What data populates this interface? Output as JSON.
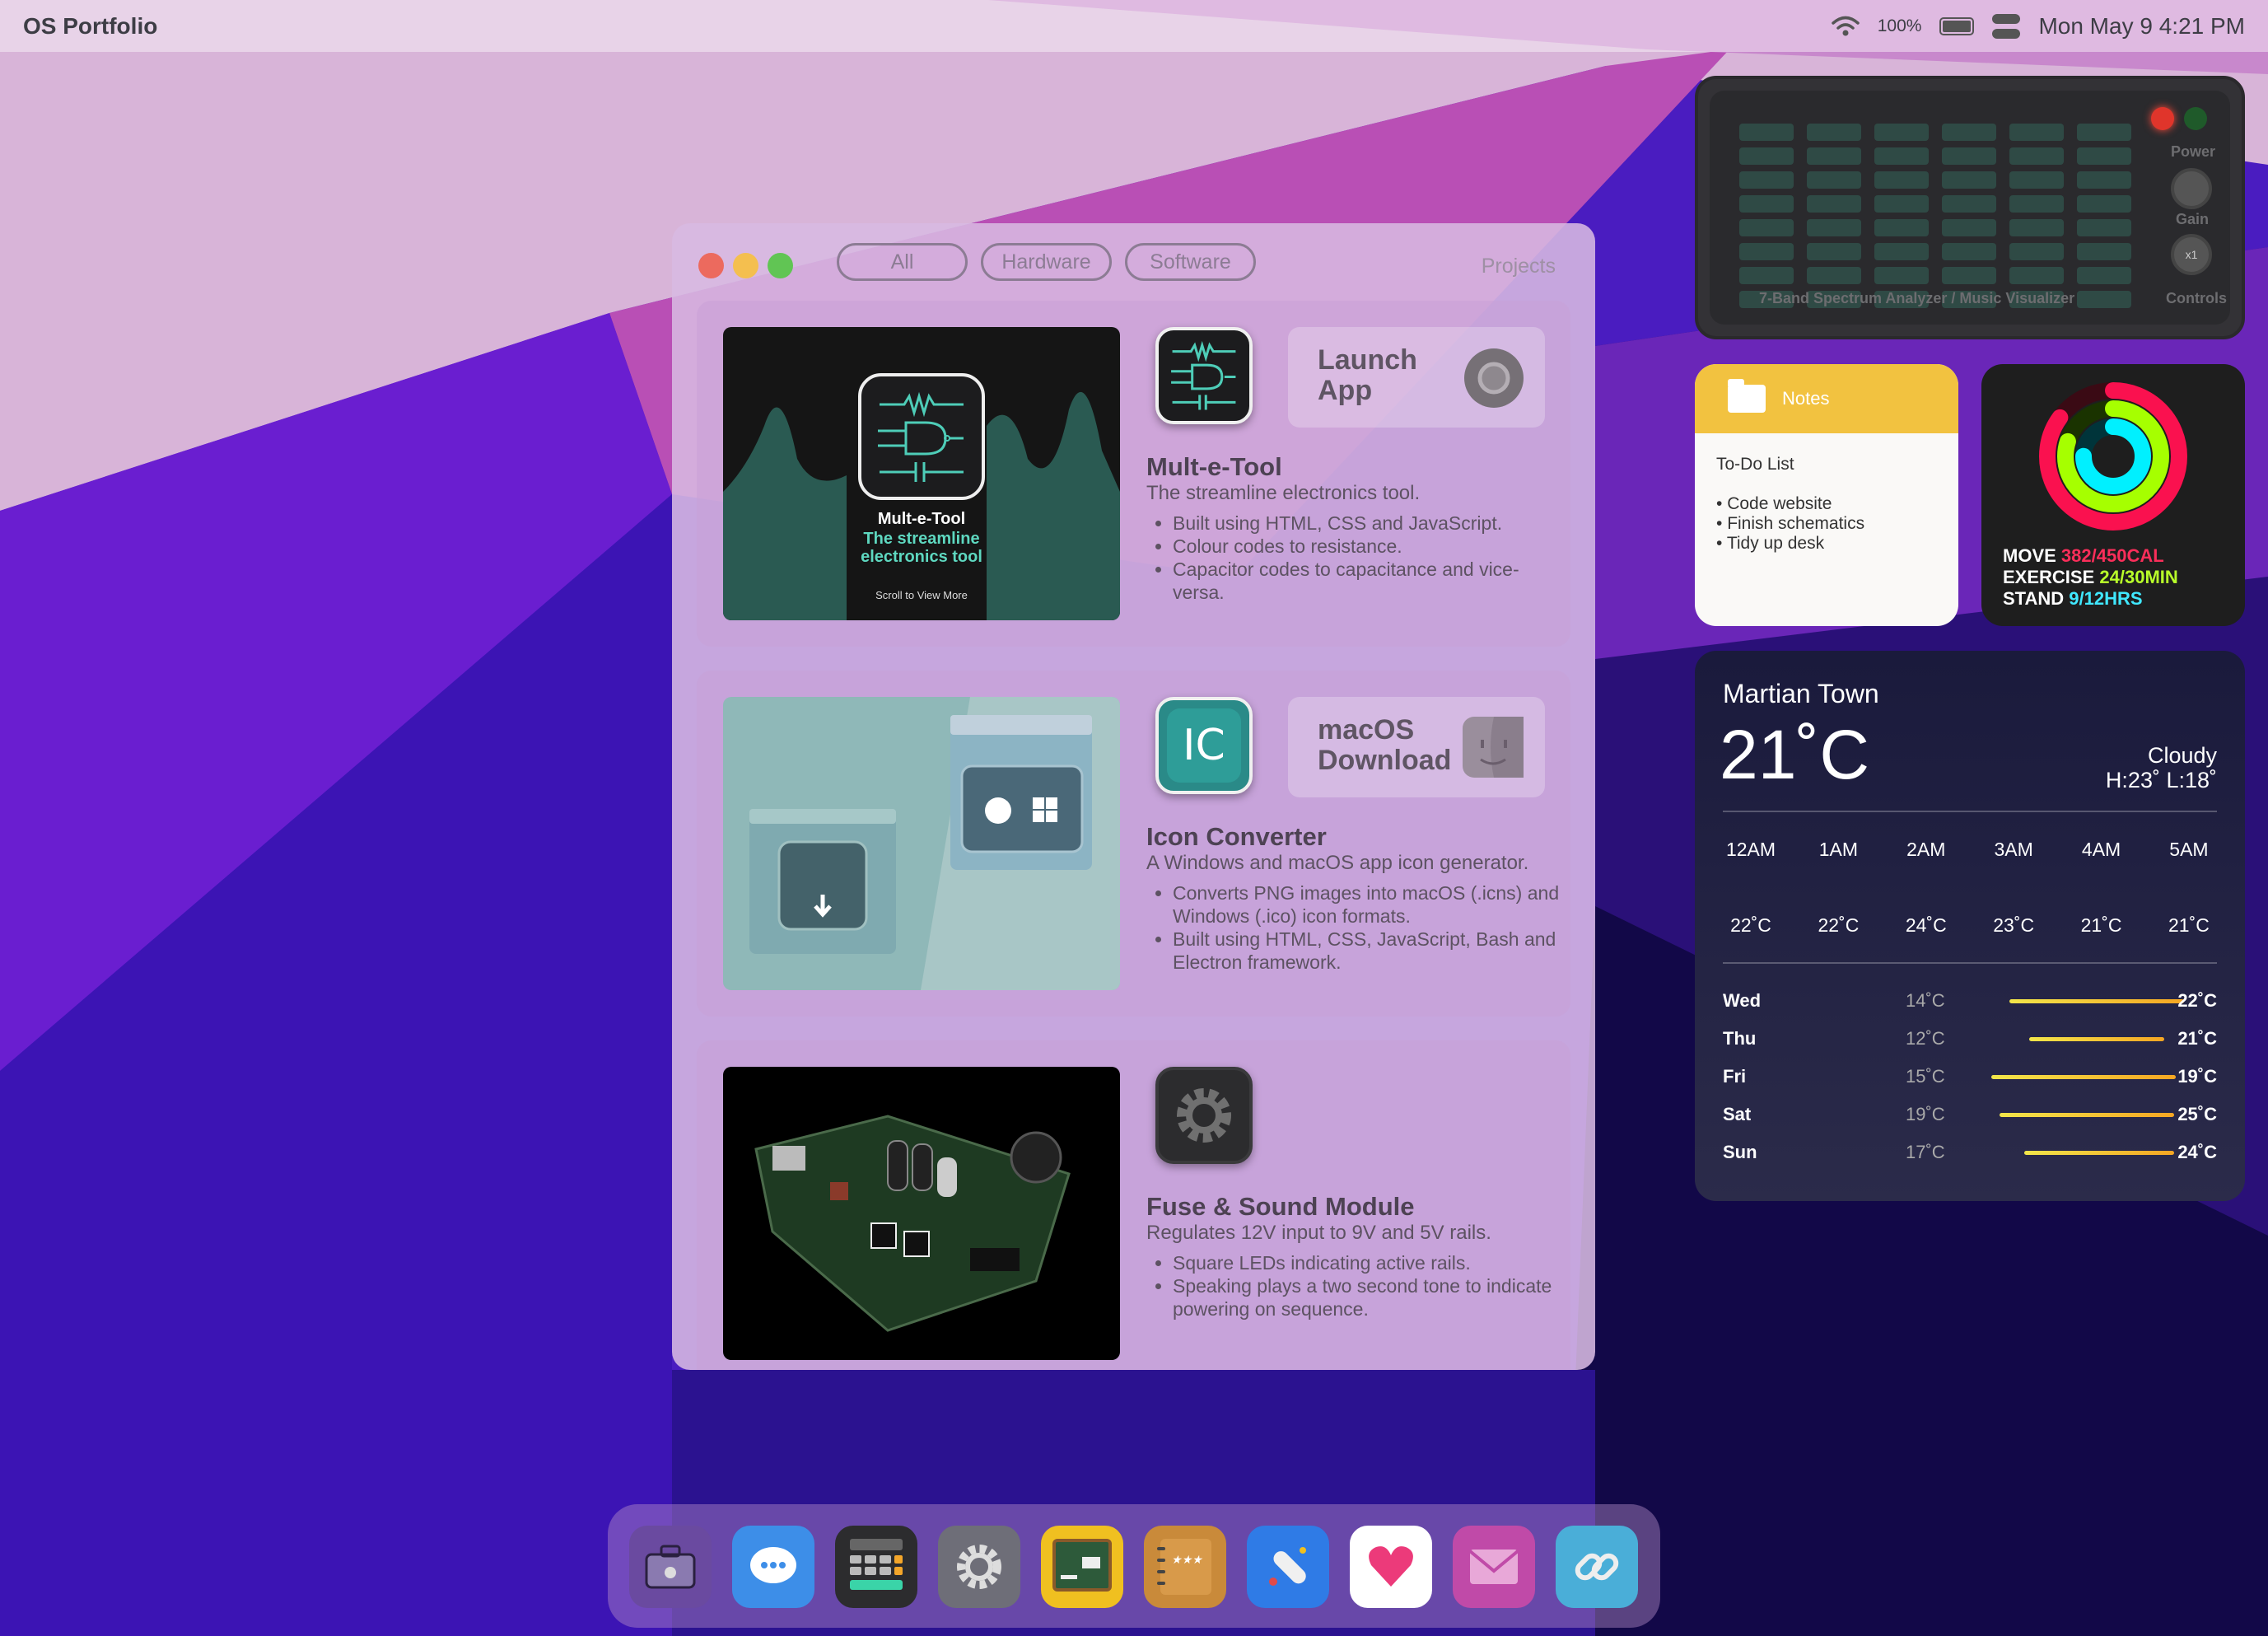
{
  "menubar": {
    "app_name": "OS Portfolio",
    "battery": "100%",
    "datetime": "Mon May 9 4:21 PM"
  },
  "projects_window": {
    "title": "Projects",
    "tabs": [
      "All",
      "Hardware",
      "Software"
    ],
    "selected_tab": "All",
    "projects": [
      {
        "name": "Mult-e-Tool",
        "description": "The streamline electronics tool.",
        "action": "Launch App",
        "action_lines": [
          "Launch",
          "App"
        ],
        "bullets": [
          "Built using HTML, CSS and JavaScript.",
          "Colour codes to resistance.",
          "Capacitor codes to capacitance and vice-versa."
        ],
        "preview": {
          "title": "Mult-e-Tool",
          "subtitle": "The streamline electronics tool",
          "hint": "Scroll to View More"
        }
      },
      {
        "name": "Icon Converter",
        "description": "A Windows and macOS app icon generator.",
        "action": "macOS Download",
        "action_lines": [
          "macOS",
          "Download"
        ],
        "icon_text": "IC",
        "bullets": [
          "Converts PNG images into macOS (.icns) and Windows (.ico) icon formats.",
          "Built using HTML, CSS, JavaScript, Bash and Electron framework."
        ]
      },
      {
        "name": "Fuse & Sound Module",
        "description": "Regulates 12V input to 9V and 5V rails.",
        "bullets": [
          "Square LEDs indicating active rails.",
          "Speaking plays a two second tone to indicate powering on sequence."
        ]
      }
    ]
  },
  "spectrum_widget": {
    "title": "7-Band Spectrum Analyzer / Music Visualizer",
    "power_label": "Power",
    "gain_label": "Gain",
    "gain_value": "x1",
    "controls_label": "Controls"
  },
  "notes_widget": {
    "header": "Notes",
    "title": "To-Do List",
    "items": [
      "Code website",
      "Finish schematics",
      "Tidy up desk"
    ]
  },
  "activity_widget": {
    "move_label": "MOVE",
    "move_value": "382/450CAL",
    "exercise_label": "EXERCISE",
    "exercise_value": "24/30MIN",
    "stand_label": "STAND",
    "stand_value": "9/12HRS",
    "move_fraction": 0.85,
    "exercise_fraction": 0.8,
    "stand_fraction": 0.75,
    "colors": {
      "move": "#fa114f",
      "exercise": "#a6ff00",
      "stand": "#00f0ff"
    }
  },
  "weather_widget": {
    "city": "Martian Town",
    "temperature": "21˚C",
    "condition": "Cloudy",
    "high_low": "H:23˚ L:18˚",
    "hourly": [
      {
        "time": "12AM",
        "temp": "22˚C"
      },
      {
        "time": "1AM",
        "temp": "22˚C"
      },
      {
        "time": "2AM",
        "temp": "24˚C"
      },
      {
        "time": "3AM",
        "temp": "23˚C"
      },
      {
        "time": "4AM",
        "temp": "21˚C"
      },
      {
        "time": "5AM",
        "temp": "21˚C"
      }
    ],
    "daily": [
      {
        "day": "Wed",
        "low": "14˚C",
        "high": "22˚C"
      },
      {
        "day": "Thu",
        "low": "12˚C",
        "high": "21˚C"
      },
      {
        "day": "Fri",
        "low": "15˚C",
        "high": "19˚C"
      },
      {
        "day": "Sat",
        "low": "19˚C",
        "high": "25˚C"
      },
      {
        "day": "Sun",
        "low": "17˚C",
        "high": "24˚C"
      }
    ]
  },
  "dock": {
    "apps": [
      {
        "icon": "briefcase-lock-icon",
        "color": "#6a4aa0"
      },
      {
        "icon": "messages-icon",
        "color": "#3d8ee8"
      },
      {
        "icon": "calculator-projects-icon",
        "color": "#2c2c2e"
      },
      {
        "icon": "settings-gear-icon",
        "color": "#6e6e78"
      },
      {
        "icon": "chalkboard-icon",
        "color": "#f0c020"
      },
      {
        "icon": "notebook-class-icon",
        "color": "#c98a3a"
      },
      {
        "icon": "diploma-icon",
        "color": "#2f7be6"
      },
      {
        "icon": "health-heart-icon",
        "color": "#ffffff"
      },
      {
        "icon": "mail-icon",
        "color": "#c04aa8"
      },
      {
        "icon": "link-icon",
        "color": "#4aaed8"
      }
    ]
  }
}
